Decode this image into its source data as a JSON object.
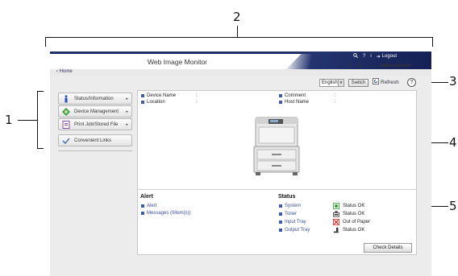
{
  "callouts": [
    "1",
    "2",
    "3",
    "4",
    "5"
  ],
  "header": {
    "title": "Web Image Monitor",
    "logout": "Logout",
    "user": "Administrator",
    "home": "Home"
  },
  "sidebar": {
    "items": [
      {
        "label": "Status/Information",
        "icon": "info-icon"
      },
      {
        "label": "Device Management",
        "icon": "device-management-icon"
      },
      {
        "label": "Print Job/Stored File",
        "icon": "document-icon"
      },
      {
        "label": "Convenient Links",
        "icon": "check-link-icon"
      }
    ]
  },
  "controls": {
    "language": "English",
    "switch": "Switch",
    "refresh": "Refresh",
    "help": "?"
  },
  "device": {
    "device_name_label": "Device Name",
    "location_label": "Location",
    "comment_label": "Comment",
    "host_name_label": "Host Name",
    "sep": ":"
  },
  "alert": {
    "title": "Alert",
    "links": [
      "Alert",
      "Messages (0item(s))"
    ]
  },
  "status": {
    "title": "Status",
    "rows": [
      {
        "name": "System",
        "value": "Status OK",
        "icon": "system-ok-icon"
      },
      {
        "name": "Toner",
        "value": "Status OK",
        "icon": "toner-icon"
      },
      {
        "name": "Input Tray",
        "value": "Out of Paper",
        "icon": "paper-error-icon"
      },
      {
        "name": "Output Tray",
        "value": "Status OK",
        "icon": "output-tray-icon"
      }
    ]
  },
  "check_details": "Check Details",
  "colors": {
    "brand": "#1f2f66",
    "link": "#3a4f9a",
    "ok": "#2aa52a",
    "error": "#d42020"
  }
}
